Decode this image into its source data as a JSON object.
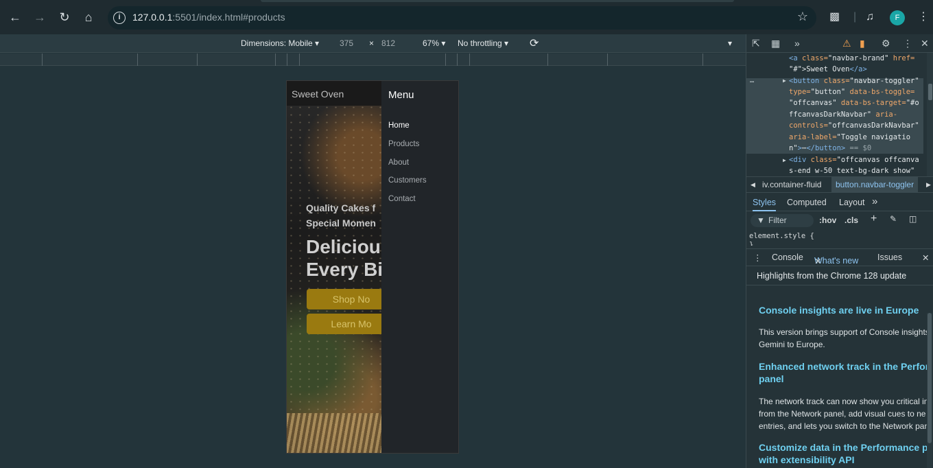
{
  "browser": {
    "url_host": "127.0.0.1",
    "url_rest": ":5501/index.html#products",
    "profile_initial": "F",
    "icons": [
      "back-icon",
      "forward-icon",
      "reload-icon",
      "home-icon",
      "info-icon",
      "star-icon",
      "extensions-icon",
      "media-icon",
      "menu-icon"
    ]
  },
  "device_toolbar": {
    "dimensions_label": "Dimensions: Mobile",
    "width": "375",
    "times": "×",
    "height": "812",
    "zoom": "67%",
    "throttling": "No throttling"
  },
  "page": {
    "brand": "Sweet Oven",
    "tagline_1": "Quality Cakes f",
    "tagline_2": "Special Momen",
    "headline_1": "Deliciou",
    "headline_2": "Every Bit",
    "shop_button": "Shop No",
    "learn_button": "Learn Mo",
    "offcanvas": {
      "title": "Menu",
      "items": [
        {
          "label": "Home",
          "active": true
        },
        {
          "label": "Products",
          "active": false
        },
        {
          "label": "About",
          "active": false
        },
        {
          "label": "Customers",
          "active": false
        },
        {
          "label": "Contact",
          "active": false
        }
      ]
    }
  },
  "devtools": {
    "code": {
      "line1_tag": "<a",
      "line1_attr": " class=",
      "line1_val": "\"navbar-brand\"",
      "line1_attr2": " href=",
      "line2_val": "\"#\"",
      "line2_text": ">Sweet Oven",
      "line2_close": "</a>",
      "line3_tag": "<button",
      "line3_attr": " class=",
      "line3_val": "\"navbar-toggler\"",
      "line4_attr": "type=",
      "line4_val": "\"button\"",
      "line4_attr2": " data-bs-toggle=",
      "line5_val": "\"offcanvas\"",
      "line5_attr": " data-bs-target=",
      "line5_val2": "\"#o",
      "line6_val": "ffcanvasDarkNavbar\"",
      "line6_attr": " aria-",
      "line7_attr": "controls=",
      "line7_val": "\"offcanvasDarkNavbar\"",
      "line8_attr": "aria-label=",
      "line8_val": "\"Toggle navigatio",
      "line9_val": "n\"",
      "line9_rest": ">",
      "line9_close": "</button>",
      "line9_eq": " == $0",
      "line10_tag": "<div",
      "line10_attr": " class=",
      "line10_val": "\"offcanvas offcanva",
      "line11_val": "s-end w-50 text-bg-dark show\""
    },
    "crumbs": [
      "iv.container-fluid",
      "button.navbar-toggler"
    ],
    "tabs": [
      "Styles",
      "Computed",
      "Layout"
    ],
    "filter_placeholder": "Filter",
    "hov": ":hov",
    "cls": ".cls",
    "element_style": "element.style {",
    "element_style_close": "}",
    "drawer_tabs": [
      "Console",
      "What's new",
      "Issues"
    ],
    "whats_new": {
      "header": "Highlights from the Chrome 128 update",
      "h1": "Console insights are live in Europe",
      "p1_a": "This version brings support of Console insights",
      "p1_b": "Gemini to Europe.",
      "h2_a": "Enhanced network track in the Perfor",
      "h2_b": "panel",
      "p2_a": "The network track can now show you critical in",
      "p2_b": "from the Network panel, add visual cues to ne",
      "p2_c": "entries, and lets you switch to the Network pan",
      "h3_a": "Customize data in the Performance p",
      "h3_b": "with extensibility API"
    }
  },
  "colors": {
    "background": "#23343a",
    "accent": "#8ec4f0",
    "button_gold": "#9a7a10",
    "offcanvas_bg": "#212529"
  }
}
